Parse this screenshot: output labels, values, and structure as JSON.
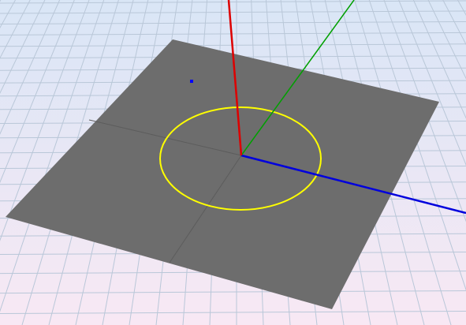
{
  "viewport": {
    "background_top": "#d9e6f6",
    "background_bottom": "#f8e8f4",
    "grid_color": "#b9c7d8",
    "plane_color": "#6d6d6d",
    "plane_guide_color": "#5c5c5c"
  },
  "axes": [
    {
      "name": "x-axis",
      "color": "#0000dd"
    },
    {
      "name": "y-axis",
      "color": "#00a000"
    },
    {
      "name": "z-axis",
      "color": "#dd0000"
    }
  ],
  "objects": [
    {
      "name": "circle-curve",
      "color": "#ffff00"
    },
    {
      "name": "point-marker",
      "color": "#0000ff"
    }
  ]
}
